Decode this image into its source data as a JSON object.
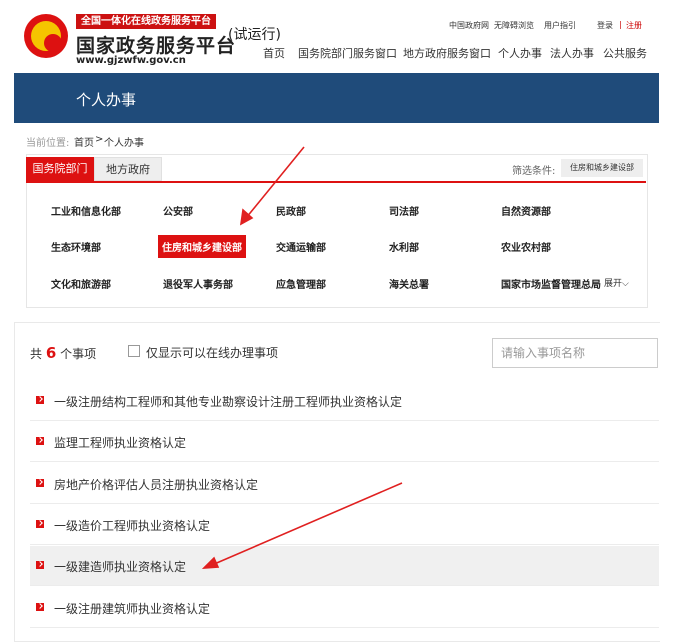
{
  "header": {
    "slogan": "全国一体化在线政务服务平台",
    "site_name": "国家政务服务平台",
    "site_url": "www.gjzwfw.gov.cn",
    "trial": "(试运行)",
    "top_links": [
      "中国政府网",
      "无障碍浏览",
      "用户指引"
    ],
    "login": "登录",
    "separator": "|",
    "register": "注册",
    "nav": [
      "首页",
      "国务院部门服务窗口",
      "地方政府服务窗口",
      "个人办事",
      "法人办事",
      "公共服务"
    ]
  },
  "banner": {
    "title": "个人办事"
  },
  "breadcrumb": {
    "prefix": "当前位置:",
    "home": "首页",
    "sep": ">",
    "current": "个人办事"
  },
  "tabs": {
    "active": "国务院部门",
    "other": "地方政府"
  },
  "filter": {
    "label": "筛选条件:",
    "value": "住房和城乡建设部"
  },
  "departments": [
    [
      "工业和信息化部",
      "公安部",
      "民政部",
      "司法部",
      "自然资源部"
    ],
    [
      "生态环境部",
      "住房和城乡建设部",
      "交通运输部",
      "水利部",
      "农业农村部"
    ],
    [
      "文化和旅游部",
      "退役军人事务部",
      "应急管理部",
      "海关总署",
      "国家市场监督管理总局"
    ]
  ],
  "expand_label": "展开",
  "list": {
    "count_prefix": "共",
    "count": "6",
    "count_suffix": "个事项",
    "online_only_label": "仅显示可以在线办理事项",
    "online_only_checked": false,
    "search_placeholder": "请输入事项名称",
    "items": [
      "一级注册结构工程师和其他专业勘察设计注册工程师执业资格认定",
      "监理工程师执业资格认定",
      "房地产价格评估人员注册执业资格认定",
      "一级造价工程师执业资格认定",
      "一级建造师执业资格认定",
      "一级注册建筑师执业资格认定"
    ]
  },
  "colors": {
    "accent": "#d11111",
    "banner": "#1f4b7a",
    "annotation": "#e02020"
  }
}
